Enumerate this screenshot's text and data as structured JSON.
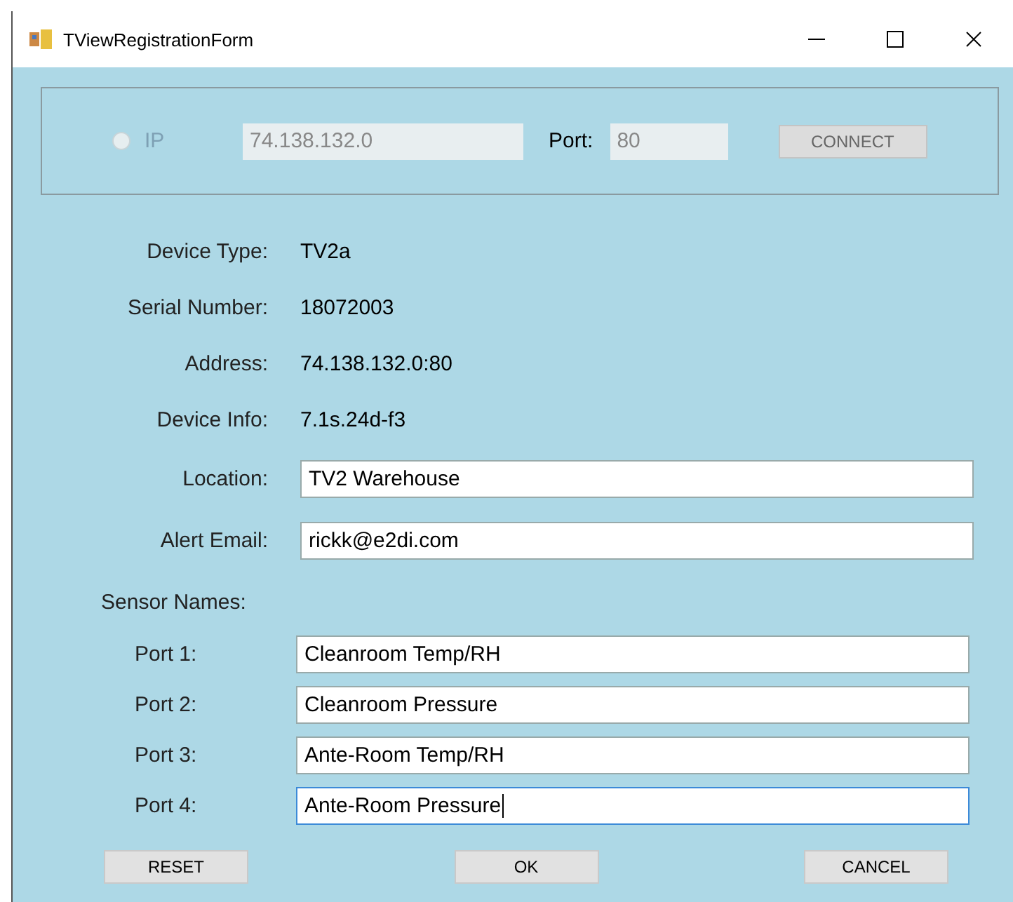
{
  "window": {
    "title": "TViewRegistrationForm"
  },
  "connection": {
    "disabled": true,
    "radio": {
      "label": "IP",
      "checked": false
    },
    "ip": "74.138.132.0",
    "port_label": "Port:",
    "port": "80",
    "connect_button": "CONNECT"
  },
  "info": [
    {
      "label": "Device Type:",
      "value": "TV2a"
    },
    {
      "label": "Serial Number:",
      "value": "18072003"
    },
    {
      "label": "Address:",
      "value": "74.138.132.0:80"
    },
    {
      "label": "Device Info:",
      "value": "7.1s.24d-f3"
    }
  ],
  "fields": [
    {
      "label": "Location:",
      "value": "TV2 Warehouse",
      "focused": false
    },
    {
      "label": "Alert Email:",
      "value": "rickk@e2di.com",
      "focused": false
    }
  ],
  "sensor_heading": "Sensor Names:",
  "sensors": [
    {
      "label": "Port 1:",
      "value": "Cleanroom Temp/RH",
      "focused": false
    },
    {
      "label": "Port 2:",
      "value": "Cleanroom Pressure",
      "focused": false
    },
    {
      "label": "Port 3:",
      "value": "Ante-Room Temp/RH",
      "focused": false
    },
    {
      "label": "Port 4:",
      "value": "Ante-Room Pressure",
      "focused": true
    }
  ],
  "buttons": [
    "RESET",
    "OK",
    "CANCEL"
  ]
}
